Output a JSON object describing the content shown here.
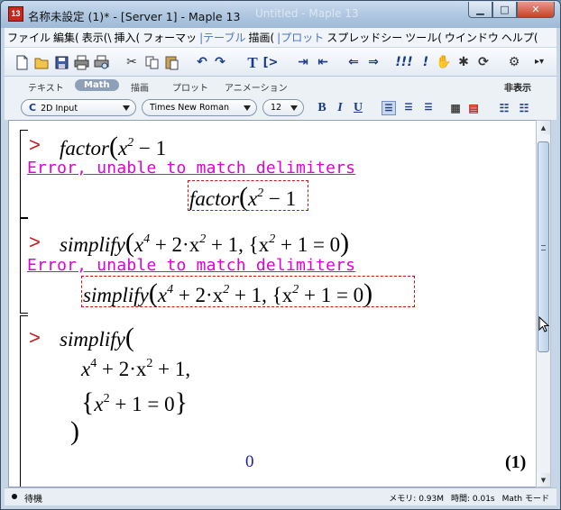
{
  "window": {
    "title": "名称未設定 (1)* - [Server 1] - Maple 13",
    "ghost_title": "Untitled - Maple 13",
    "app_icon_text": "13"
  },
  "menu": [
    "ファイル",
    "編集(",
    "表示(\\",
    "挿入(",
    "フォーマッ",
    "|テーブル",
    "描画(",
    "|プロット",
    "スプレッドシー",
    "ツール(",
    "ウインドウ",
    "ヘルプ("
  ],
  "palette_tabs": {
    "items": [
      "テキスト",
      "Math",
      "描画",
      "プロット",
      "アニメーション"
    ],
    "active": "Math",
    "hide": "非表示"
  },
  "format": {
    "mode": "2D Input",
    "mode_icon": "C",
    "font": "Times New Roman",
    "size": "12",
    "bold": "B",
    "italic": "I",
    "underline": "U"
  },
  "worksheet": {
    "prompt": ">",
    "block1": {
      "input_fn": "factor",
      "input_expr": "x",
      "input_exp": "2",
      "input_tail": " − 1",
      "error": "Error, unable to match delimiters",
      "echo_fn": "factor",
      "echo_expr": "x",
      "echo_exp": "2",
      "echo_tail": " − 1"
    },
    "block2": {
      "fn": "simplify",
      "t1": "x",
      "e1": "4",
      "t2": " + 2·x",
      "e2": "2",
      "t3": " + 1,  {x",
      "e3": "2",
      "t4": " + 1 = 0",
      "error": "Error, unable to match delimiters"
    },
    "block3": {
      "fn": "simplify",
      "line1_a": "x",
      "line1_e1": "4",
      "line1_b": " + 2·x",
      "line1_e2": "2",
      "line1_c": " + 1,",
      "line2_a": "x",
      "line2_e": "2",
      "line2_b": " + 1 = 0",
      "close": ")",
      "output": "0",
      "label": "(1)"
    }
  },
  "status": {
    "state": "待機",
    "memory": "メモリ: 0.93M",
    "time": "時間: 0.01s",
    "mode": "Math モード"
  }
}
